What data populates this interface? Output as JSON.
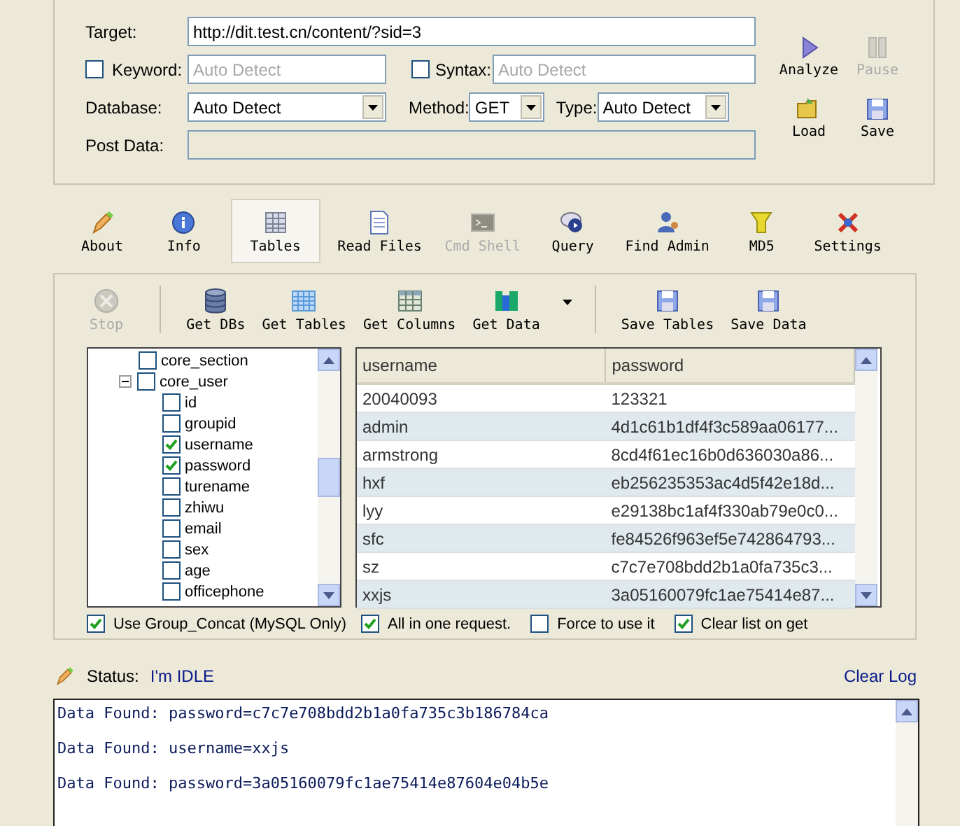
{
  "target": {
    "label": "Target:",
    "value": "http://dit.test.cn/content/?sid=3"
  },
  "keyword": {
    "label": "Keyword:",
    "checked": false,
    "placeholder": "Auto Detect"
  },
  "syntax": {
    "label": "Syntax:",
    "checked": false,
    "placeholder": "Auto Detect"
  },
  "database": {
    "label": "Database:",
    "value": "Auto Detect"
  },
  "method": {
    "label": "Method:",
    "value": "GET"
  },
  "type": {
    "label": "Type:",
    "value": "Auto Detect"
  },
  "post_data": {
    "label": "Post Data:",
    "disabled": true
  },
  "actions": [
    {
      "label": "Analyze",
      "disabled": false
    },
    {
      "label": "Pause",
      "disabled": true
    },
    {
      "label": "Load",
      "disabled": false
    },
    {
      "label": "Save",
      "disabled": false
    }
  ],
  "tabs": [
    {
      "label": "About",
      "selected": false,
      "disabled": false
    },
    {
      "label": "Info",
      "selected": false,
      "disabled": false
    },
    {
      "label": "Tables",
      "selected": true,
      "disabled": false
    },
    {
      "label": "Read Files",
      "selected": false,
      "disabled": false
    },
    {
      "label": "Cmd Shell",
      "selected": false,
      "disabled": true
    },
    {
      "label": "Query",
      "selected": false,
      "disabled": false
    },
    {
      "label": "Find Admin",
      "selected": false,
      "disabled": false
    },
    {
      "label": "MD5",
      "selected": false,
      "disabled": false
    },
    {
      "label": "Settings",
      "selected": false,
      "disabled": false
    }
  ],
  "toolbar": [
    {
      "label": "Stop",
      "disabled": true
    },
    {
      "label": "Get DBs",
      "disabled": false
    },
    {
      "label": "Get Tables",
      "disabled": false
    },
    {
      "label": "Get Columns",
      "disabled": false
    },
    {
      "label": "Get Data",
      "disabled": false
    },
    {
      "label": "Save Tables",
      "disabled": false
    },
    {
      "label": "Save Data",
      "disabled": false
    }
  ],
  "tree": [
    {
      "label": "core_section",
      "checked": false
    },
    {
      "label": "core_user",
      "checked": false,
      "expanded": true,
      "children": [
        {
          "label": "id",
          "checked": false
        },
        {
          "label": "groupid",
          "checked": false
        },
        {
          "label": "username",
          "checked": true
        },
        {
          "label": "password",
          "checked": true
        },
        {
          "label": "turename",
          "checked": false
        },
        {
          "label": "zhiwu",
          "checked": false
        },
        {
          "label": "email",
          "checked": false
        },
        {
          "label": "sex",
          "checked": false
        },
        {
          "label": "age",
          "checked": false
        },
        {
          "label": "officephone",
          "checked": false
        }
      ]
    }
  ],
  "grid": {
    "columns": [
      "username",
      "password"
    ],
    "rows": [
      [
        "20040093",
        "123321"
      ],
      [
        "admin",
        "4d1c61b1df4f3c589aa06177..."
      ],
      [
        "armstrong",
        "8cd4f61ec16b0d636030a86..."
      ],
      [
        "hxf",
        "eb256235353ac4d5f42e18d..."
      ],
      [
        "lyy",
        "e29138bc1af4f330ab79e0c0..."
      ],
      [
        "sfc",
        "fe84526f963ef5e742864793..."
      ],
      [
        "sz",
        "c7c7e708bdd2b1a0fa735c3..."
      ],
      [
        "xxjs",
        "3a05160079fc1ae75414e87..."
      ]
    ]
  },
  "group_concat": {
    "label": "Use Group_Concat (MySQL Only)",
    "checked": true
  },
  "grid_options": [
    {
      "label": "All in one request.",
      "checked": true
    },
    {
      "label": "Force to use it",
      "checked": false
    },
    {
      "label": "Clear list on get",
      "checked": true
    }
  ],
  "status": {
    "label": "Status:",
    "value": "I'm IDLE"
  },
  "clear_log": "Clear Log",
  "log": [
    "Data Found: password=c7c7e708bdd2b1a0fa735c3b186784ca",
    "Data Found: username=xxjs",
    "Data Found: password=3a05160079fc1ae75414e87604e04b5e"
  ]
}
